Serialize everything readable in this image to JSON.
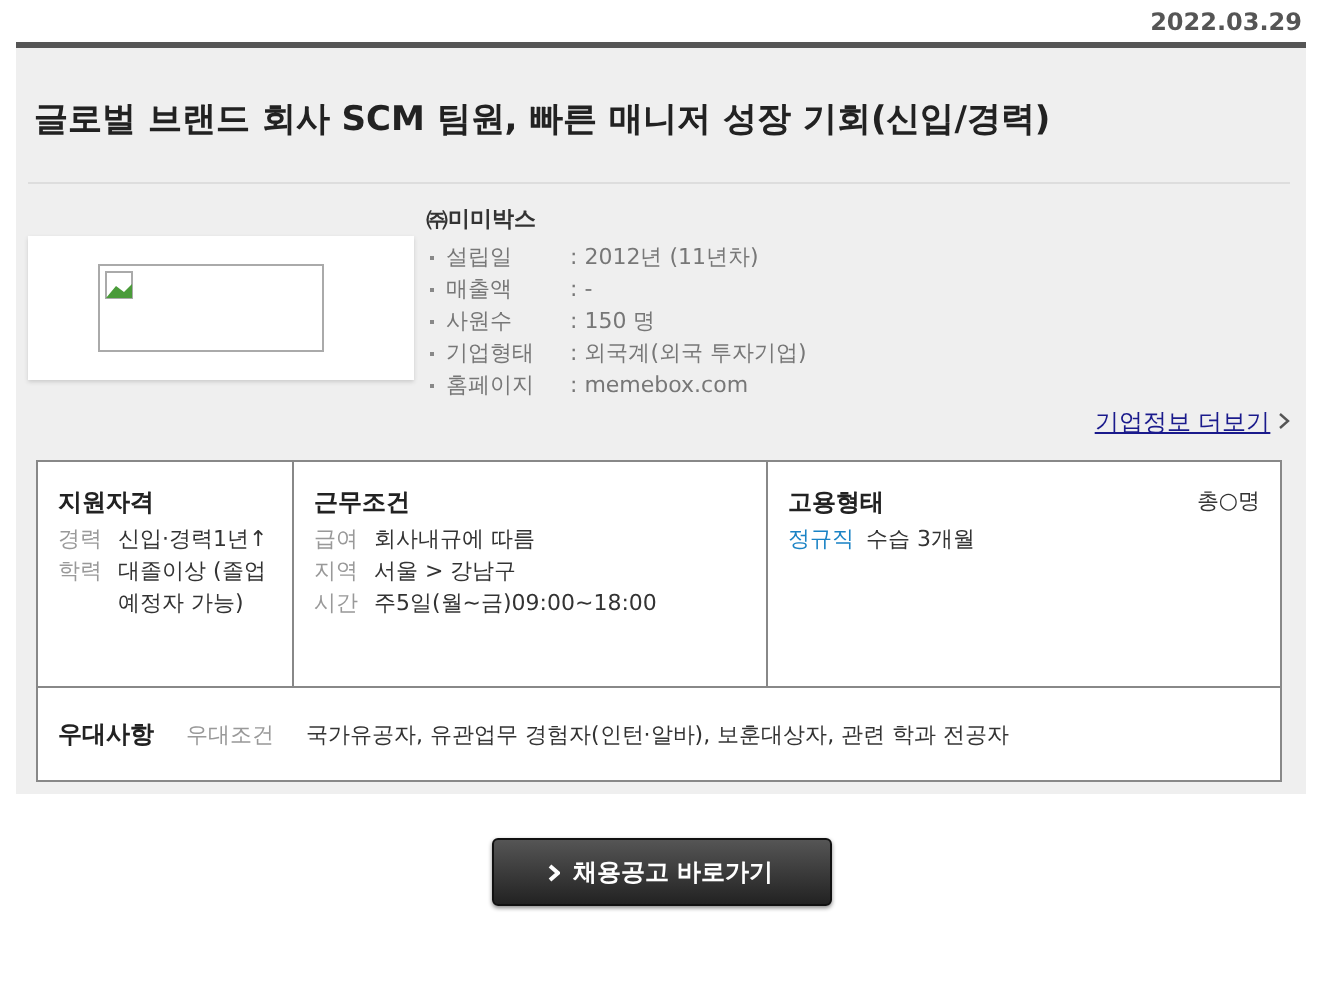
{
  "date": "2022.03.29",
  "title": "글로벌 브랜드 회사 SCM 팀원, 빠른 매니저 성장 기회(신입/경력)",
  "company": {
    "name": "㈜미미박스",
    "facts": [
      {
        "label": "설립일",
        "value": ": 2012년 (11년차)"
      },
      {
        "label": "매출액",
        "value": ": -"
      },
      {
        "label": "사원수",
        "value": ": 150 명"
      },
      {
        "label": "기업형태",
        "value": ": 외국계(외국 투자기업)"
      },
      {
        "label": "홈페이지",
        "value": ": memebox.com"
      }
    ],
    "more_link": "기업정보 더보기"
  },
  "qualification": {
    "heading": "지원자격",
    "rows": [
      {
        "label": "경력",
        "value": "신입·경력1년↑"
      },
      {
        "label": "학력",
        "value": "대졸이상 (졸업예정자 가능)"
      }
    ]
  },
  "conditions": {
    "heading": "근무조건",
    "rows": [
      {
        "label": "급여",
        "value": "회사내규에 따름"
      },
      {
        "label": "지역",
        "value": "서울 > 강남구"
      },
      {
        "label": "시간",
        "value": "주5일(월~금)09:00~18:00"
      }
    ]
  },
  "employment": {
    "heading": "고용형태",
    "headcount": "총○명",
    "type": "정규직",
    "note": "수습 3개월"
  },
  "preference": {
    "heading": "우대사항",
    "label": "우대조건",
    "value": "국가유공자, 유관업무 경험자(인턴·알바), 보훈대상자, 관련 학과 전공자"
  },
  "apply_button": "채용공고 바로가기"
}
